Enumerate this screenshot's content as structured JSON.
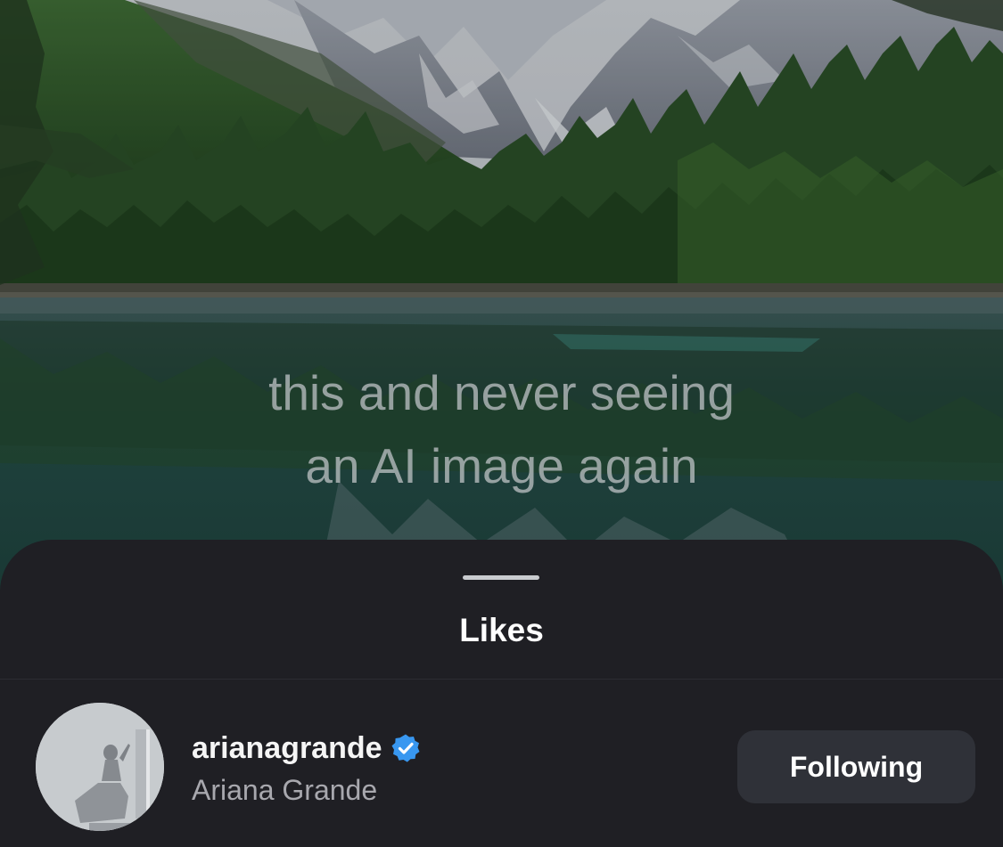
{
  "post": {
    "caption_line1": "this and never seeing",
    "caption_line2": "an AI image again"
  },
  "sheet": {
    "title": "Likes"
  },
  "likes": [
    {
      "username": "arianagrande",
      "full_name": "Ariana Grande",
      "verified": true,
      "verified_icon": "verified-badge-icon",
      "button_label": "Following"
    }
  ],
  "colors": {
    "sheet_background": "#1f1f24",
    "button_background": "#2f3138",
    "verified_blue": "#3897f0"
  }
}
